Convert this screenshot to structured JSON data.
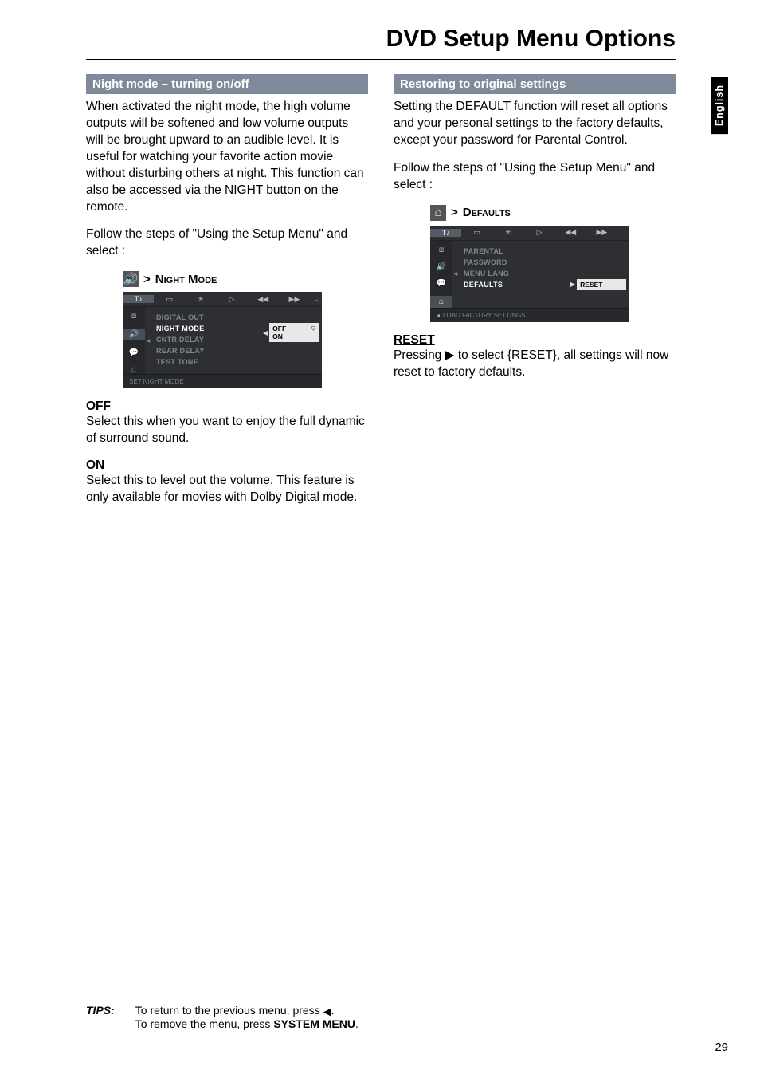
{
  "page_title": "DVD Setup Menu Options",
  "language_tab": "English",
  "page_number": "29",
  "left": {
    "header": "Night mode – turning on/off",
    "p1": "When activated the night mode, the high volume outputs will be softened and low volume outputs will be brought upward to an audible level.  It is useful for watching your favorite action movie without disturbing others at night. This function can also be accessed via the NIGHT button on the remote.",
    "p2": "Follow the steps of \"Using the Setup Menu\" and select :",
    "osd_label_prefix": ">",
    "osd_label": "Night Mode",
    "off_h": "OFF",
    "off_p": "Select this when you want to enjoy the full dynamic of surround sound.",
    "on_h": "ON",
    "on_p": "Select this to level out the volume. This feature is only available for movies with Dolby Digital mode."
  },
  "right": {
    "header": "Restoring to original settings",
    "p1": "Setting the DEFAULT function will reset all options and your personal settings to the factory defaults, except your password for Parental Control.",
    "p2": "Follow the steps of \"Using the Setup Menu\" and select :",
    "osd_label_prefix": ">",
    "osd_label": "Defaults",
    "reset_h": "RESET",
    "reset_p": "Pressing ▶ to select {RESET},  all settings will now reset to factory defaults."
  },
  "osd_night": {
    "tabs": [
      "T♪",
      "▭",
      "✳",
      "▷",
      "◀◀",
      "▶▶"
    ],
    "side": [
      "⧈",
      "🔊",
      "💬",
      "⌂"
    ],
    "items": [
      "DIGITAL OUT",
      "NIGHT MODE",
      "CNTR DELAY",
      "REAR DELAY",
      "TEST TONE"
    ],
    "values": [
      "OFF",
      "ON"
    ],
    "hint": "SET NIGHT MODE"
  },
  "osd_defaults": {
    "tabs": [
      "T♪",
      "▭",
      "✳",
      "▷",
      "◀◀",
      "▶▶"
    ],
    "side": [
      "⧈",
      "🔊",
      "💬",
      "⌂"
    ],
    "items": [
      "PARENTAL",
      "PASSWORD",
      "MENU LANG",
      "DEFAULTS"
    ],
    "value": "RESET",
    "hint": "LOAD FACTORY SETTINGS"
  },
  "tips": {
    "label": "TIPS:",
    "line1a": "To return to the previous menu, press ",
    "line1b": ".",
    "line2a": "To remove the menu, press ",
    "line2b": "SYSTEM MENU",
    "line2c": "."
  }
}
